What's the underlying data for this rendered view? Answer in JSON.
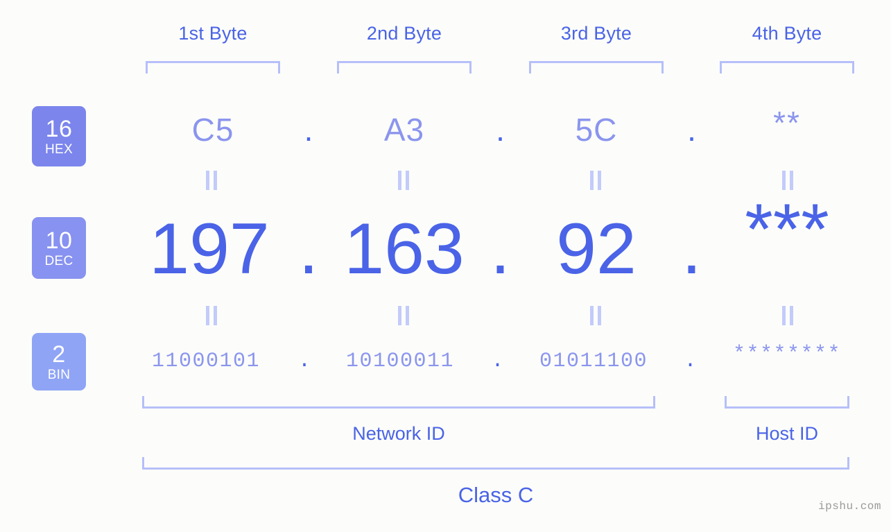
{
  "theme": {
    "background": "#fcfdfa",
    "accent_strong": "#4a63e7",
    "accent_light": "#8b95ee",
    "bracket": "#b6bffa",
    "equals": "#c3cbfb",
    "badge_hex": "#7b85ec",
    "badge_dec": "#8892f0",
    "badge_bin": "#8fa4f5",
    "watermark": "#9a9a9a"
  },
  "byte_headers": [
    {
      "label": "1st Byte"
    },
    {
      "label": "2nd Byte"
    },
    {
      "label": "3rd Byte"
    },
    {
      "label": "4th Byte"
    }
  ],
  "badges": {
    "hex": {
      "base": "16",
      "abbr": "HEX"
    },
    "dec": {
      "base": "10",
      "abbr": "DEC"
    },
    "bin": {
      "base": "2",
      "abbr": "BIN"
    }
  },
  "separator": ".",
  "rows": {
    "hex": {
      "name": "hexadecimal",
      "bytes": [
        "C5",
        "A3",
        "5C",
        "**"
      ]
    },
    "dec": {
      "name": "decimal",
      "bytes": [
        "197",
        "163",
        "92",
        "***"
      ]
    },
    "bin": {
      "name": "binary",
      "bytes": [
        "11000101",
        "10100011",
        "01011100",
        "********"
      ]
    }
  },
  "segments": {
    "network_id": "Network ID",
    "host_id": "Host ID",
    "class": "Class C"
  },
  "watermark": "ipshu.com"
}
